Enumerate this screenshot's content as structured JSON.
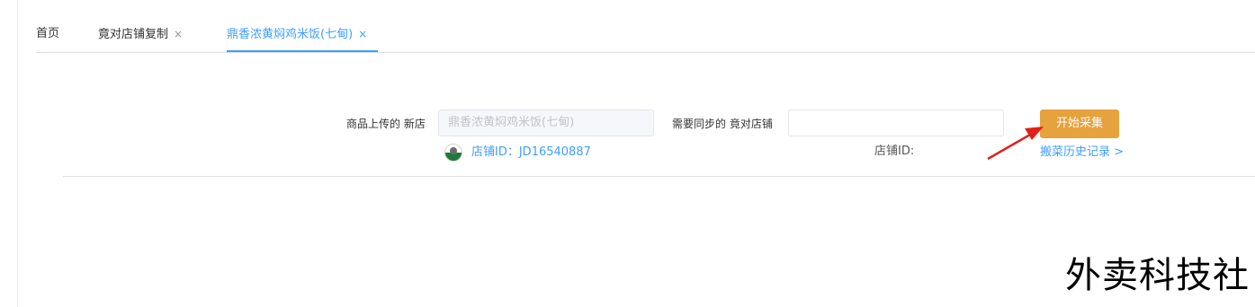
{
  "tabs": [
    {
      "label": "首页",
      "closable": false,
      "active": false
    },
    {
      "label": "竟对店铺复制",
      "closable": true,
      "active": false
    },
    {
      "label": "鼎香浓黄焖鸡米饭(七甸)",
      "closable": true,
      "active": true
    }
  ],
  "close_glyph": "×",
  "form": {
    "upload_label": "商品上传的 新店",
    "upload_store_value": "鼎香浓黄焖鸡米饭(七甸)",
    "sync_label": "需要同步的 竟对店铺",
    "sync_store_value": "",
    "start_button": "开始采集",
    "store_id_text": "店铺ID：JD16540887",
    "target_id_text": "店铺ID:",
    "history_link": "搬菜历史记录 >"
  },
  "watermark": "外卖科技社",
  "colors": {
    "accent": "#409eff",
    "button": "#e6a23c",
    "annotation_arrow": "#e0201a"
  },
  "icons": {
    "store_logo": "store-logo-icon",
    "tab_close": "close-icon",
    "annotation": "red-arrow-icon"
  }
}
